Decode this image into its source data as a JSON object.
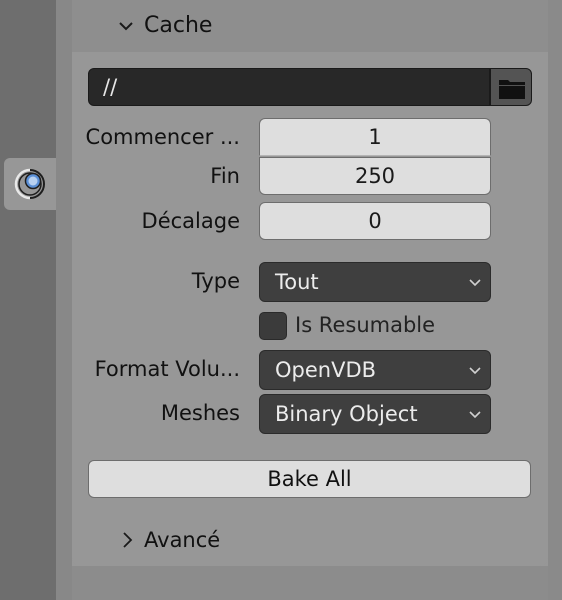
{
  "panel": {
    "header": {
      "label": "Cache",
      "expanded": true
    },
    "cache_path": "//",
    "fields": {
      "frame_start": {
        "label": "Commencer ...",
        "value": "1"
      },
      "frame_end": {
        "label": "Fin",
        "value": "250"
      },
      "frame_offset": {
        "label": "Décalage",
        "value": "0"
      }
    },
    "type": {
      "label": "Type",
      "value": "Tout"
    },
    "is_resumable": {
      "label": "Is Resumable",
      "checked": false
    },
    "volume_format": {
      "label": "Format Volu...",
      "value": "OpenVDB"
    },
    "meshes": {
      "label": "Meshes",
      "value": "Binary Object"
    },
    "bake_button": "Bake All",
    "advanced": {
      "label": "Avancé",
      "expanded": false
    }
  },
  "icons": {
    "tab": "physics-fluid-icon",
    "folder": "folder-icon"
  },
  "colors": {
    "panel_bg": "#979797",
    "field_bg": "#dedede",
    "dropdown_bg": "#3f3f3f",
    "path_bg": "#282828"
  }
}
